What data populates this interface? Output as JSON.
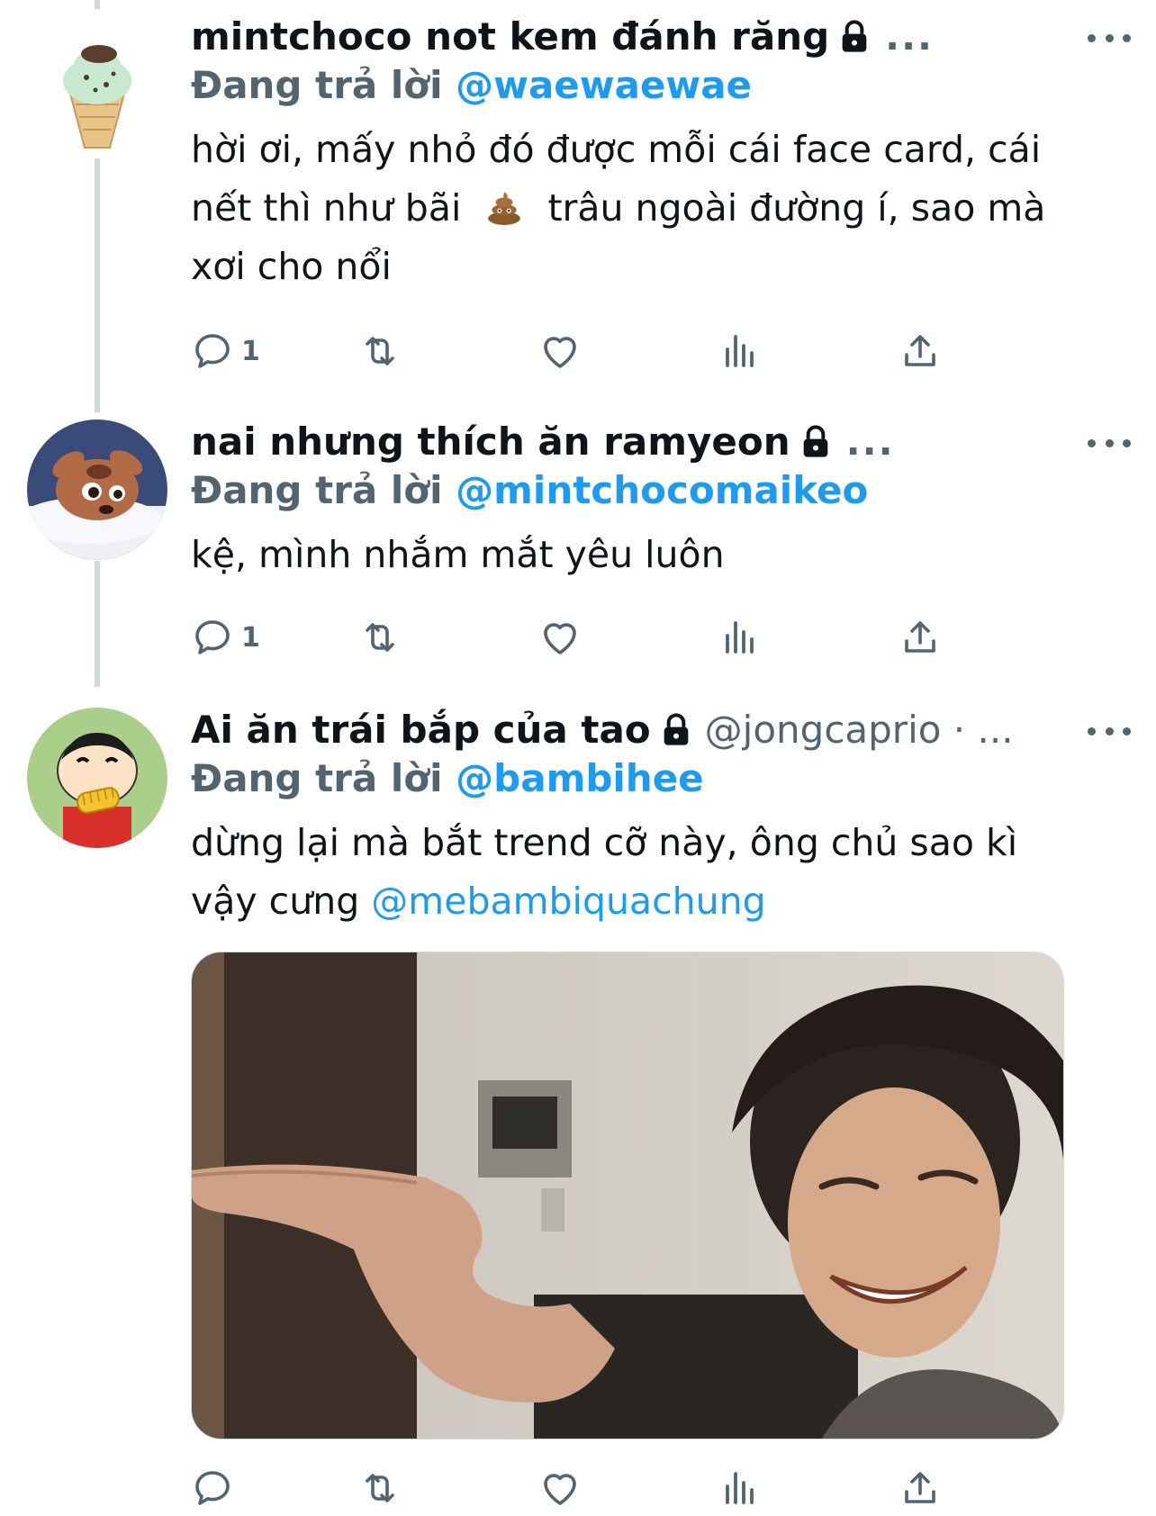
{
  "colors": {
    "link": "#1d9bf0",
    "muted": "#536471",
    "thread_line": "#cfd9de"
  },
  "tweets": [
    {
      "display_name": "mintchoco not kem đánh răng",
      "handle": "",
      "ellipsis": "...",
      "reply_prefix": "Đang trả lời",
      "reply_to": "@waewaewae",
      "body_line1": "hời ơi, mấy nhỏ đó được mỗi cái face card, cái",
      "body_line2a": "nết thì như bãi",
      "body_emoji": "poop-emoji",
      "body_line2b": "trâu ngoài đường í, sao mà",
      "body_line3": "xơi cho nổi",
      "reply_count": "1",
      "avatar_icon": "mint-ice-cream-cone-avatar"
    },
    {
      "display_name": "nai nhưng thích ăn ramyeon",
      "handle": "",
      "ellipsis": "...",
      "reply_prefix": "Đang trả lời",
      "reply_to": "@mintchocomaikeo",
      "body_line1": "kệ, mình nhắm mắt yêu luôn",
      "reply_count": "1",
      "avatar_icon": "cartoon-fawn-avatar"
    },
    {
      "display_name": "Ai ăn trái bắp của tao",
      "handle": "@jongcaprio · ...",
      "ellipsis": "",
      "reply_prefix": "Đang trả lời",
      "reply_to": "@bambihee",
      "body_line1": "dừng lại mà bắt trend cỡ này, ông chủ sao kì",
      "body_line2a": "vậy cưng",
      "body_mention": "@mebambiquachung",
      "reply_count": "",
      "avatar_icon": "cartoon-boy-eating-corn-avatar",
      "media": "photo-man-laughing-pointing"
    }
  ],
  "action_icons": [
    "reply-icon",
    "retweet-icon",
    "like-icon",
    "views-icon",
    "share-icon"
  ]
}
